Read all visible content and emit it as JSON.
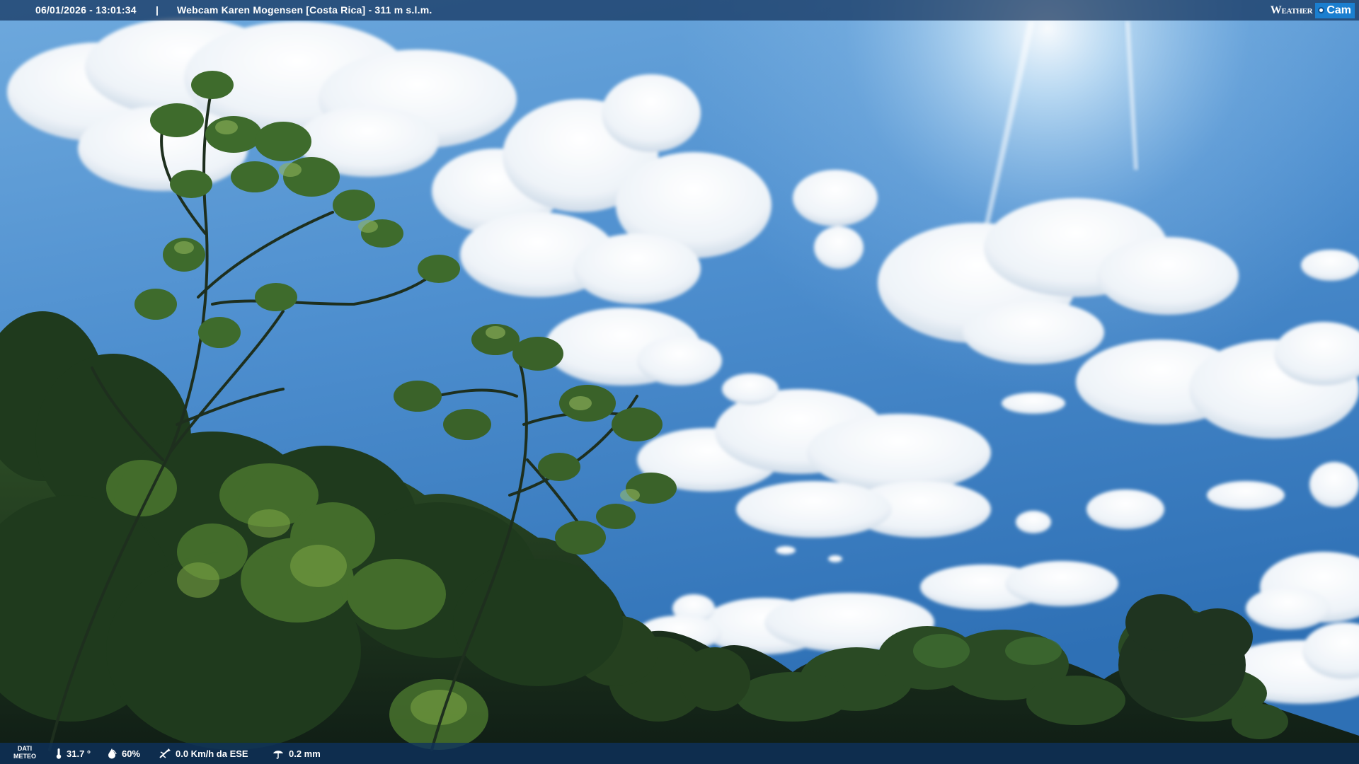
{
  "overlay": {
    "datetime": "06/01/2026 - 13:01:34",
    "separator": "|",
    "title": "Webcam Karen Mogensen [Costa Rica] - 311 m s.l.m.",
    "brand": {
      "weather": "Weather",
      "cam": "Cam"
    }
  },
  "weather_bar": {
    "label_line1": "DATI",
    "label_line2": "METEO",
    "temperature": "31.7 °",
    "humidity": "60%",
    "wind": "0.0 Km/h da ESE",
    "rain": "0.2 mm"
  },
  "icons": [
    "thermometer-icon",
    "humidity-drop-icon",
    "wind-vane-icon",
    "rain-gauge-icon",
    "camera-lens-icon"
  ],
  "colors": {
    "sky_top": "#8fc0ea",
    "sky_bottom": "#2f73b8",
    "foliage_dark": "#16281a",
    "foliage_light": "#6f9a3c",
    "bar_bg": "#12325c",
    "brand_blue": "#1b7fd0"
  }
}
